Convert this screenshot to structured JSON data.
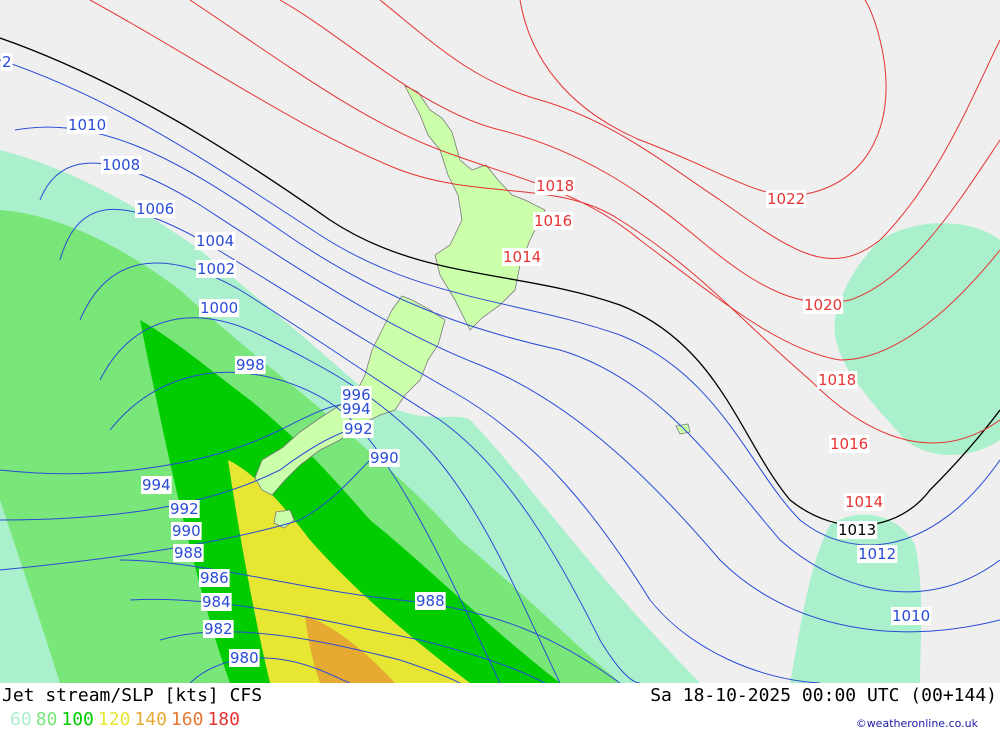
{
  "footer": {
    "title_left": "Jet stream/SLP [kts] CFS",
    "title_right": "Sa 18-10-2025 00:00 UTC (00+144)",
    "credit": "©weatheronline.co.uk"
  },
  "legend": [
    {
      "label": "60",
      "color": "#aaf0cc"
    },
    {
      "label": "80",
      "color": "#78e678"
    },
    {
      "label": "100",
      "color": "#00cc00"
    },
    {
      "label": "120",
      "color": "#e6e633"
    },
    {
      "label": "140",
      "color": "#e6aa33"
    },
    {
      "label": "160",
      "color": "#e67833"
    },
    {
      "label": "180",
      "color": "#e63333"
    }
  ],
  "colors": {
    "sea": "#efefef",
    "land": "#ccffaa",
    "isobar_low": "#2a4bd7",
    "isobar_high": "#e63333",
    "isobar_ref": "#000000"
  },
  "isobar_labels": {
    "blue": [
      "2",
      "1010",
      "1008",
      "1006",
      "1004",
      "1002",
      "1000",
      "998",
      "996",
      "994",
      "992",
      "990",
      "994",
      "992",
      "990",
      "988",
      "986",
      "984",
      "982",
      "980",
      "988",
      "1012",
      "1010"
    ],
    "red": [
      "1018",
      "1016",
      "1014",
      "1022",
      "1020",
      "1018",
      "1016",
      "1014"
    ],
    "black": [
      "1013"
    ]
  }
}
